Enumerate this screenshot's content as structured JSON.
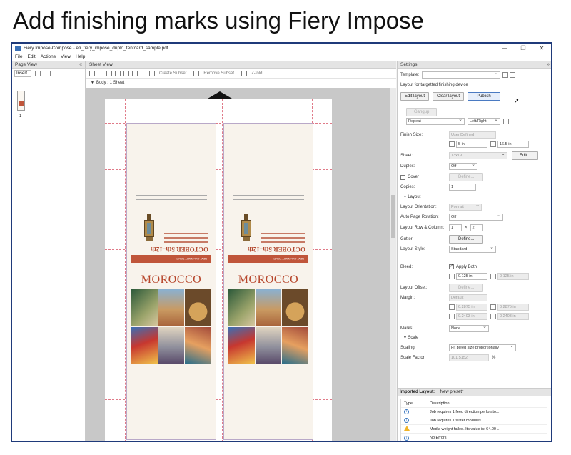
{
  "slide": {
    "title": "Add finishing marks using Fiery Impose"
  },
  "window": {
    "title": "Fiery Impose-Compose - efi_fiery_impose_duplo_tentcard_sample.pdf",
    "min": "—",
    "max": "❐",
    "close": "✕"
  },
  "menu": [
    "File",
    "Edit",
    "Actions",
    "View",
    "Help"
  ],
  "page_view": {
    "header": "Page View",
    "insert": "Insert",
    "page_number": "1"
  },
  "sheet_view": {
    "header": "Sheet View",
    "create_subset": "Create Subset",
    "remove_subset": "Remove Subset",
    "z_fold": "Z-fold",
    "body_label": "Body : 1 Sheet",
    "card": {
      "tour": "NEW CULINARY TOUR",
      "dates": "OCTOBER 5th–12th",
      "title": "MOROCCO"
    }
  },
  "settings": {
    "header": "Settings",
    "template_label": "Template:",
    "layout_desc": "Layout for targetted finishing device",
    "edit_layout": "Edit layout",
    "clear_layout": "Clear layout",
    "publish": "Publish",
    "gangup": "Gangup",
    "repeat": "Repeat",
    "direction": "Left/Right",
    "finish_size_label": "Finish Size:",
    "finish_size": "User Defined",
    "width": "5 in",
    "height": "16.5 in",
    "sheet_label": "Sheet:",
    "sheet": "13x19",
    "sheet_edit": "Edit...",
    "duplex_label": "Duplex:",
    "duplex": "Off",
    "cover_label": "Cover",
    "cover_define": "Define...",
    "copies_label": "Copies:",
    "copies": "1",
    "layout_section": "Layout",
    "orientation_label": "Layout Orientation:",
    "orientation": "Portrait",
    "rotation_label": "Auto Page Rotation:",
    "rotation": "Off",
    "rowcol_label": "Layout Row & Column:",
    "rows": "1",
    "times": "×",
    "cols": "2",
    "gutter_label": "Gutter:",
    "gutter_define": "Define...",
    "style_label": "Layout Style:",
    "style": "Standard",
    "bleed_label": "Bleed:",
    "apply_both": "Apply Both",
    "bleed_a": "0.125 in",
    "bleed_b": "0.125 in",
    "offset_label": "Layout Offset:",
    "offset_define": "Define...",
    "margin_label": "Margin:",
    "margin_mode": "Default",
    "m1": "0.2875 in",
    "m2": "0.2875 in",
    "m3": "0.2403 in",
    "m4": "0.2403 in",
    "marks_label": "Marks:",
    "marks": "None",
    "scale_section": "Scale",
    "scaling_label": "Scaling:",
    "scaling": "Fit bleed size proportionally",
    "scale_factor_label": "Scale Factor:",
    "scale_factor": "101.5152",
    "percent": "%"
  },
  "imported": {
    "title": "Imported Layout:",
    "preset": "New preset*",
    "col_type": "Type",
    "col_desc": "Description",
    "messages": [
      "Job requires 1 feed direction perforato...",
      "Job requires 1 slitter modules.",
      "Media weight failed. Its value is: 64.00 ...",
      "No Errors"
    ]
  }
}
